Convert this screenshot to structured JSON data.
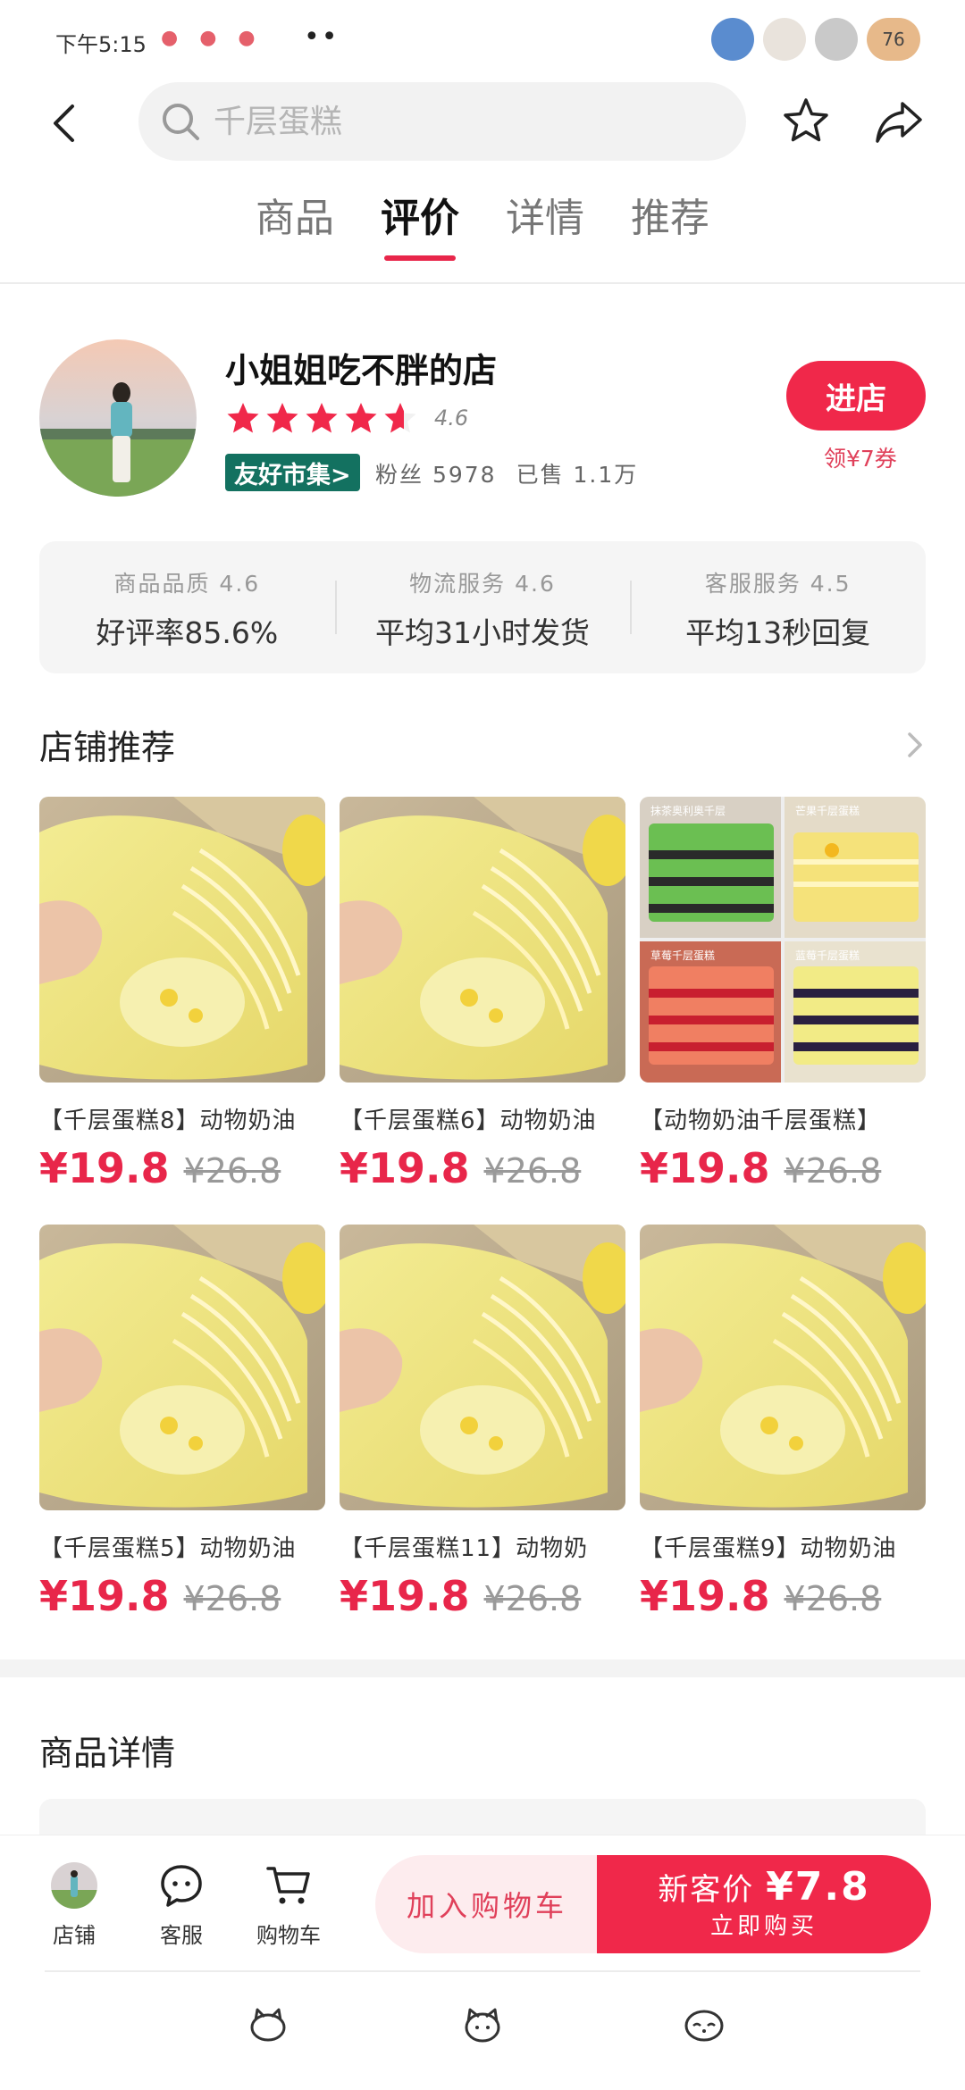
{
  "status_bar": {
    "time": "下午5:15",
    "left_icons": [
      "pig-icon",
      "pig-icon",
      "pig-icon"
    ],
    "dots": "••",
    "right_icons": [
      "cat-icon",
      "cat-icon",
      "cat-icon",
      "fish-icon"
    ],
    "battery": "76"
  },
  "nav": {
    "search_placeholder": "千层蛋糕"
  },
  "tabs": [
    "商品",
    "评价",
    "详情",
    "推荐"
  ],
  "active_tab_index": 1,
  "shop": {
    "name": "小姐姐吃不胖的店",
    "rating": "4.6",
    "rating_value": 4.6,
    "badge": "友好市集>",
    "fans": "粉丝 5978",
    "sold": "已售 1.1万",
    "enter_label": "进店",
    "coupon": "领¥7券"
  },
  "service": [
    {
      "label": "商品品质 4.6",
      "value": "好评率85.6%"
    },
    {
      "label": "物流服务 4.6",
      "value": "平均31小时发货"
    },
    {
      "label": "客服服务 4.5",
      "value": "平均13秒回复"
    }
  ],
  "recommend": {
    "title": "店铺推荐",
    "products": [
      {
        "title": "【千层蛋糕8】动物奶油",
        "price": "¥19.8",
        "old_price": "¥26.8",
        "image": "crepe"
      },
      {
        "title": "【千层蛋糕6】动物奶油",
        "price": "¥19.8",
        "old_price": "¥26.8",
        "image": "crepe"
      },
      {
        "title": "【动物奶油千层蛋糕】",
        "price": "¥19.8",
        "old_price": "¥26.8",
        "image": "collage",
        "collage_labels": [
          "抹茶奥利奥千层",
          "芒果千层蛋糕",
          "草莓千层蛋糕",
          "蓝莓千层蛋糕"
        ]
      },
      {
        "title": "【千层蛋糕5】动物奶油",
        "price": "¥19.8",
        "old_price": "¥26.8",
        "image": "crepe"
      },
      {
        "title": "【千层蛋糕11】动物奶",
        "price": "¥19.8",
        "old_price": "¥26.8",
        "image": "crepe"
      },
      {
        "title": "【千层蛋糕9】动物奶油",
        "price": "¥19.8",
        "old_price": "¥26.8",
        "image": "crepe"
      }
    ]
  },
  "detail": {
    "title": "商品详情"
  },
  "bottom_bar": {
    "shop_label": "店铺",
    "service_label": "客服",
    "cart_label": "购物车",
    "add_cart": "加入购物车",
    "new_price_label": "新客价",
    "new_price": "¥7.8",
    "buy_now": "立即购买"
  },
  "colors": {
    "accent": "#f0284a",
    "price": "#e8264a",
    "badge_green": "#137160"
  }
}
